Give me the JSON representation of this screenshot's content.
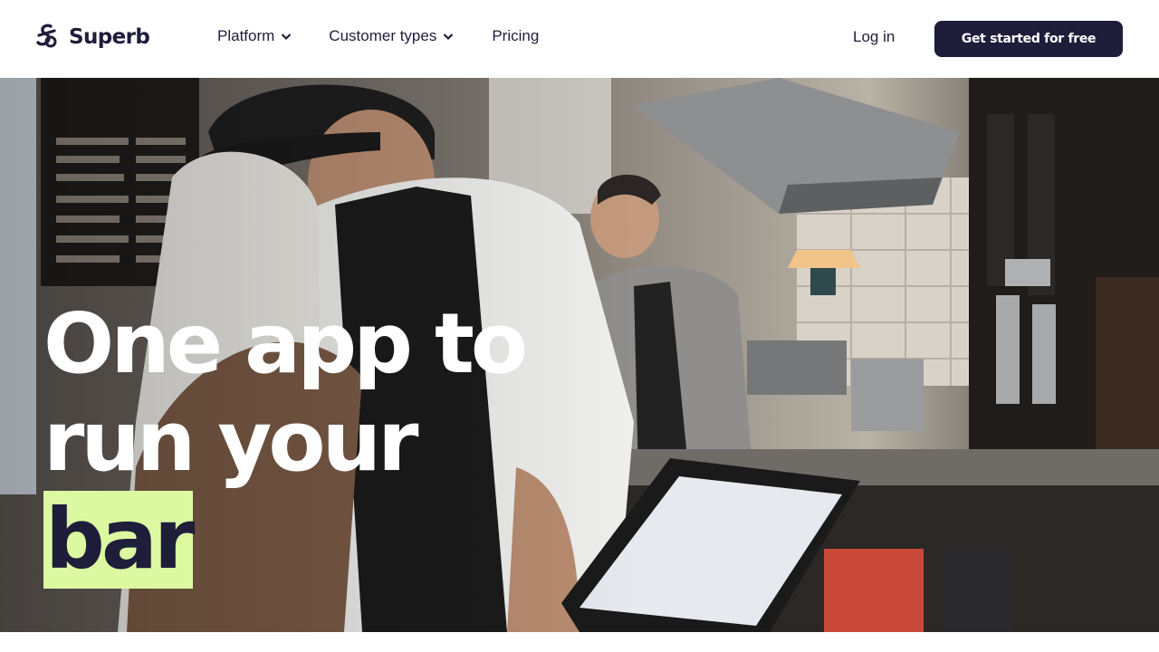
{
  "brand": {
    "name": "Superb",
    "color": "#1e1d3a"
  },
  "nav": {
    "items": [
      {
        "label": "Platform",
        "icon": "chevron-down-icon"
      },
      {
        "label": "Customer types",
        "icon": "chevron-down-icon"
      },
      {
        "label": "Pricing"
      }
    ]
  },
  "header": {
    "login_label": "Log in",
    "cta_label": "Get started for free"
  },
  "hero": {
    "headline_line1": "One app to",
    "headline_line2": "run your",
    "headline_highlight": "bar",
    "highlight_color": "#dcf9a2",
    "image": "photo of bartenders working behind a bar counter with a point-of-sale tablet"
  }
}
